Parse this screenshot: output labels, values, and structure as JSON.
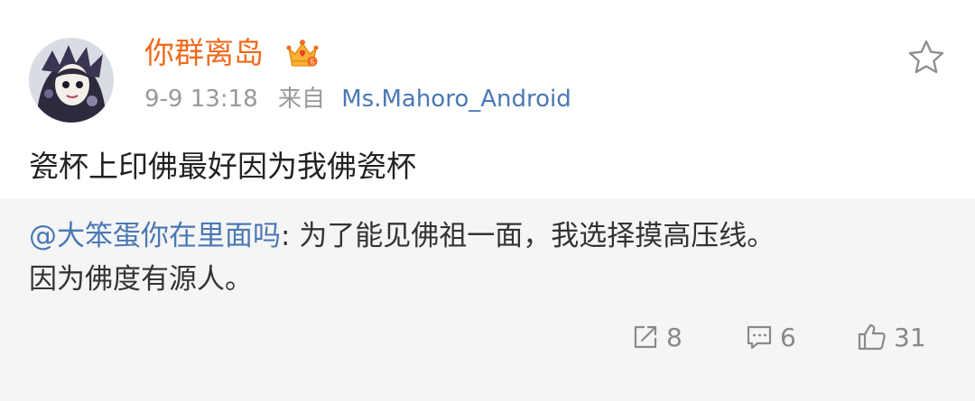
{
  "post": {
    "username": "你群离岛",
    "timestamp": "9-9 13:18",
    "from_label": "来自",
    "source": "Ms.Mahoro_Android",
    "text": "瓷杯上印佛最好因为我佛瓷杯"
  },
  "repost": {
    "author": "@大笨蛋你在里面吗",
    "separator": ": ",
    "text_line1": "为了能见佛祖一面，我选择摸高压线。",
    "text_line2": "因为佛度有源人。"
  },
  "actions": {
    "share_count": "8",
    "comment_count": "6",
    "like_count": "31"
  },
  "icons": {
    "avatar": "avatar-image",
    "badge": "vip-crown-icon",
    "favorite": "star-icon",
    "share": "share-icon",
    "comment": "comment-icon",
    "like": "thumbs-up-icon"
  },
  "colors": {
    "username": "#f06a1d",
    "link": "#4a78b5",
    "meta": "#999999",
    "repost_bg": "#f5f5f5"
  }
}
